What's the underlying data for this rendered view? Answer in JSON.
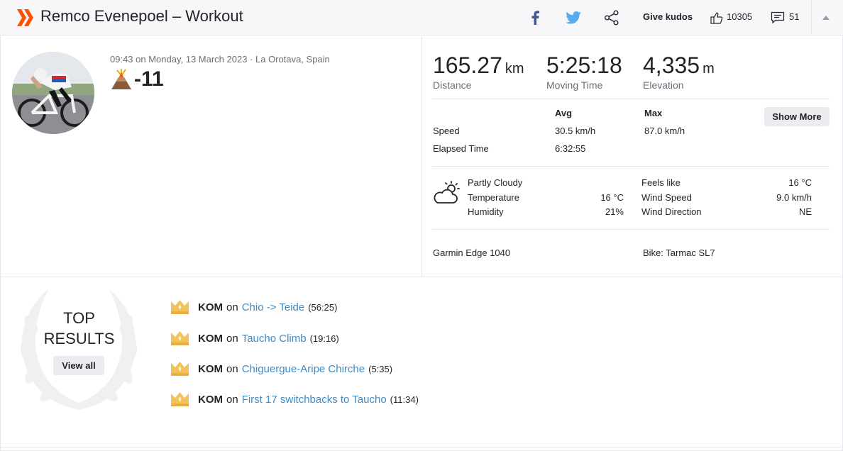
{
  "header": {
    "title": "Remco Evenepoel – Workout",
    "give_kudos": "Give kudos",
    "kudos_count": "10305",
    "comments_count": "51",
    "icons": [
      "strava-chevron-logo",
      "facebook-icon",
      "twitter-icon",
      "share-icon",
      "thumbs-up-icon",
      "comment-icon",
      "caret-up-icon"
    ],
    "brand_color": "#fc5200"
  },
  "activity": {
    "meta": "09:43 on Monday, 13 March 2023 · La Orotava, Spain",
    "suffer_score": "-11"
  },
  "stats": {
    "distance": {
      "value": "165.27",
      "unit": "km",
      "label": "Distance"
    },
    "moving_time": {
      "value": "5:25:18",
      "label": "Moving Time"
    },
    "elevation": {
      "value": "4,335",
      "unit": "m",
      "label": "Elevation"
    }
  },
  "more_stats": {
    "col_avg": "Avg",
    "col_max": "Max",
    "show_more": "Show More",
    "rows": [
      {
        "label": "Speed",
        "avg": "30.5 km/h",
        "max": "87.0 km/h"
      },
      {
        "label": "Elapsed Time",
        "avg": "6:32:55",
        "max": ""
      }
    ]
  },
  "weather": {
    "condition": "Partly Cloudy",
    "temperature_label": "Temperature",
    "temperature": "16 °C",
    "humidity_label": "Humidity",
    "humidity": "21%",
    "feels_like_label": "Feels like",
    "feels_like": "16 °C",
    "wind_speed_label": "Wind Speed",
    "wind_speed": "9.0 km/h",
    "wind_direction_label": "Wind Direction",
    "wind_direction": "NE"
  },
  "device": {
    "device_name": "Garmin Edge 1040",
    "bike": "Bike: Tarmac SL7"
  },
  "top_results": {
    "title_line1": "TOP",
    "title_line2": "RESULTS",
    "view_all": "View all",
    "items": [
      {
        "badge": "KOM",
        "on": "on",
        "segment": "Chio -> Teide",
        "time": "(56:25)"
      },
      {
        "badge": "KOM",
        "on": "on",
        "segment": "Taucho Climb",
        "time": "(19:16)"
      },
      {
        "badge": "KOM",
        "on": "on",
        "segment": "Chiguergue-Aripe Chirche",
        "time": "(5:35)"
      },
      {
        "badge": "KOM",
        "on": "on",
        "segment": "First 17 switchbacks to Taucho",
        "time": "(11:34)"
      }
    ]
  }
}
